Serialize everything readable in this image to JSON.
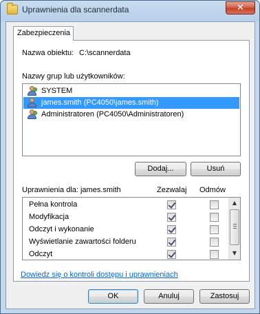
{
  "window": {
    "title": "Uprawnienia dla scannerdata",
    "close_glyph": "✕"
  },
  "tab_label": "Zabezpieczenia",
  "object": {
    "label": "Nazwa obiektu:",
    "value": "C:\\scannerdata"
  },
  "groups_label": "Nazwy grup lub użytkowników:",
  "principals": [
    {
      "name": "SYSTEM",
      "icon": "group-users-icon"
    },
    {
      "name": "james.smith (PC4050\\james.smith)",
      "icon": "user-icon",
      "selected": true
    },
    {
      "name": "Administratoren (PC4050\\Administratoren)",
      "icon": "group-users-icon"
    }
  ],
  "buttons": {
    "add": "Dodaj...",
    "remove": "Usuń",
    "ok": "OK",
    "cancel": "Anuluj",
    "apply": "Zastosuj"
  },
  "permissions": {
    "header": "Uprawnienia dla: james.smith",
    "allow_header": "Zezwalaj",
    "deny_header": "Odmów",
    "rows": [
      {
        "name": "Pełna kontrola",
        "allow": true,
        "deny": false
      },
      {
        "name": "Modyfikacja",
        "allow": true,
        "deny": false
      },
      {
        "name": "Odczyt i wykonanie",
        "allow": true,
        "deny": false
      },
      {
        "name": "Wyświetlanie zawartości folderu",
        "allow": true,
        "deny": false
      },
      {
        "name": "Odczyt",
        "allow": true,
        "deny": false
      }
    ]
  },
  "help_link": "Dowiedz się o kontroli dostępu i uprawnieniach",
  "scroll_arrows": {
    "up": "▲",
    "down": "▼"
  }
}
